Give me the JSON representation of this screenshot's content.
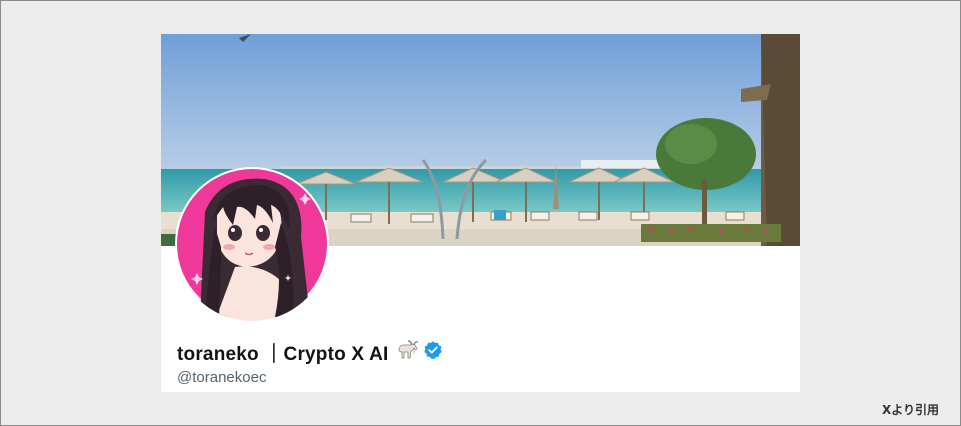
{
  "profile": {
    "display_name": "toraneko ｜Crypto X AI",
    "handle": "@toranekoec",
    "verified": true,
    "emoji_icon": "goat-icon",
    "verified_icon": "verified-badge-icon",
    "verified_color": "#1d9bf0",
    "avatar_bg_color": "#f0389a"
  },
  "footer": {
    "source_label": "Xより引用"
  }
}
